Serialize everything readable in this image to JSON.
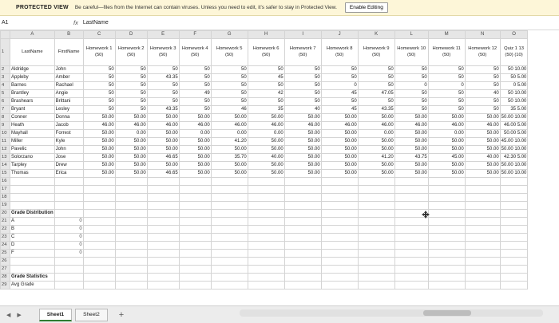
{
  "protected_view": {
    "title": "PROTECTED VIEW",
    "message": "Be careful—files from the Internet can contain viruses. Unless you need to edit, it's safer to stay in Protected View.",
    "button": "Enable Editing"
  },
  "formula_bar": {
    "name_box": "A1",
    "fx": "fx",
    "value": "LastName"
  },
  "column_letters": [
    "A",
    "B",
    "C",
    "D",
    "E",
    "F",
    "G",
    "H",
    "I",
    "J",
    "K",
    "L",
    "M",
    "N",
    "O"
  ],
  "headers": [
    "LastName",
    "FirstName",
    "Homework 1 (50)",
    "Homework 2 (50)",
    "Homework 3 (50)",
    "Homework 4 (50)",
    "Homework 5 (50)",
    "Homework 6 (50)",
    "Homework 7 (50)",
    "Homework 8 (50)",
    "Homework 9 (50)",
    "Homework 10 (50)",
    "Homework 11 (50)",
    "Homework 12 (50)",
    "Quiz 1 13 (50) (10)"
  ],
  "rows": [
    [
      "Aldridge",
      "John",
      "50",
      "50",
      "50",
      "50",
      "50",
      "50",
      "50",
      "50",
      "50",
      "50",
      "50",
      "50",
      "50  10.00"
    ],
    [
      "Appleby",
      "Amber",
      "50",
      "50",
      "43.35",
      "50",
      "50",
      "45",
      "50",
      "50",
      "50",
      "50",
      "50",
      "50",
      "50  5.00"
    ],
    [
      "Barnes",
      "Rachael",
      "50",
      "50",
      "50",
      "50",
      "50",
      "50",
      "50",
      "0",
      "50",
      "0",
      "0",
      "50",
      "0  5.00"
    ],
    [
      "Brantley",
      "Angie",
      "50",
      "50",
      "50",
      "49",
      "50",
      "42",
      "50",
      "45",
      "47.05",
      "50",
      "50",
      "40",
      "50  10.00"
    ],
    [
      "Brashears",
      "Brittani",
      "50",
      "50",
      "50",
      "50",
      "50",
      "50",
      "50",
      "50",
      "50",
      "50",
      "50",
      "50",
      "50  10.00"
    ],
    [
      "Bryant",
      "Lesley",
      "50",
      "50",
      "43.35",
      "50",
      "46",
      "35",
      "40",
      "45",
      "43.35",
      "50",
      "50",
      "50",
      "35  5.00"
    ],
    [
      "Conner",
      "Donna",
      "50.00",
      "50.00",
      "50.00",
      "50.00",
      "50.00",
      "50.00",
      "50.00",
      "50.00",
      "50.00",
      "50.00",
      "50.00",
      "50.00",
      "50.00  10.00"
    ],
    [
      "Heath",
      "Jacob",
      "46.00",
      "46.00",
      "46.00",
      "46.00",
      "46.00",
      "46.00",
      "46.00",
      "46.00",
      "46.00",
      "46.00",
      "46.00",
      "46.00",
      "46.00  5.00"
    ],
    [
      "Mayhall",
      "Forrest",
      "50.00",
      "0.00",
      "50.00",
      "0.00",
      "0.00",
      "0.00",
      "50.00",
      "50.00",
      "0.00",
      "50.00",
      "0.00",
      "50.00",
      "50.00  5.00"
    ],
    [
      "Miller",
      "Kyle",
      "50.00",
      "50.00",
      "50.00",
      "50.00",
      "41.20",
      "50.00",
      "50.00",
      "50.00",
      "50.00",
      "50.00",
      "50.00",
      "50.00",
      "45.00  10.00"
    ],
    [
      "Pavelic",
      "John",
      "50.00",
      "50.00",
      "50.00",
      "50.00",
      "50.00",
      "50.00",
      "50.00",
      "50.00",
      "50.00",
      "50.00",
      "50.00",
      "50.00",
      "50.00  10.00"
    ],
    [
      "Solorzano",
      "Jose",
      "50.00",
      "50.00",
      "46.65",
      "50.00",
      "35.70",
      "40.00",
      "50.00",
      "50.00",
      "41.20",
      "43.75",
      "45.00",
      "40.00",
      "42.30  5.00"
    ],
    [
      "Tarpley",
      "Drew",
      "50.00",
      "50.00",
      "50.00",
      "50.00",
      "50.00",
      "50.00",
      "50.00",
      "50.00",
      "50.00",
      "50.00",
      "50.00",
      "50.00",
      "50.00  10.00"
    ],
    [
      "Thomas",
      "Erica",
      "50.00",
      "50.00",
      "46.65",
      "50.00",
      "50.00",
      "50.00",
      "50.00",
      "50.00",
      "50.00",
      "50.00",
      "50.00",
      "50.00",
      "50.00  10.00"
    ]
  ],
  "grade_distribution": {
    "title": "Grade Distribution",
    "items": [
      {
        "grade": "A",
        "count": "0"
      },
      {
        "grade": "B",
        "count": "0"
      },
      {
        "grade": "C",
        "count": "0"
      },
      {
        "grade": "D",
        "count": "0"
      },
      {
        "grade": "F",
        "count": "0"
      }
    ]
  },
  "grade_statistics": {
    "title": "Grade Statistics",
    "first_label": "Avg Grade"
  },
  "sheets": [
    {
      "label": "Sheet1",
      "active": true
    },
    {
      "label": "Sheet2",
      "active": false
    }
  ],
  "add_sheet": "+"
}
